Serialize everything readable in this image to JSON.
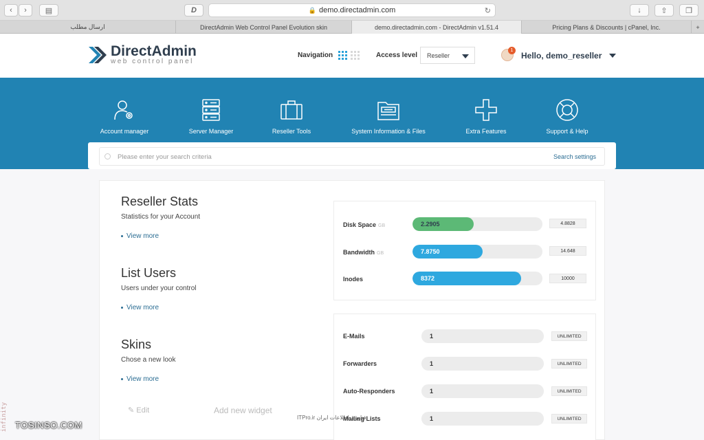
{
  "browser": {
    "url": "demo.directadmin.com",
    "tabs": [
      {
        "label": "ارسال مطلب",
        "active": false
      },
      {
        "label": "DirectAdmin Web Control Panel Evolution skin",
        "active": false
      },
      {
        "label": "demo.directadmin.com - DirectAdmin v1.51.4",
        "active": true
      },
      {
        "label": "Pricing Plans & Discounts | cPanel, Inc.",
        "active": false
      }
    ],
    "new_tab": "+"
  },
  "header": {
    "logo_title": "DirectAdmin",
    "logo_subtitle": "web control panel",
    "navigation_label": "Navigation",
    "access_level_label": "Access level",
    "access_level_value": "Reseller",
    "notification_count": "1",
    "greeting": "Hello, demo_reseller"
  },
  "main_menu": [
    {
      "label": "Account manager",
      "icon": "users-gear-icon"
    },
    {
      "label": "Server Manager",
      "icon": "server-icon"
    },
    {
      "label": "Reseller Tools",
      "icon": "briefcase-icon"
    },
    {
      "label": "System Information & Files",
      "icon": "folder-icon"
    },
    {
      "label": "Extra Features",
      "icon": "plus-icon"
    },
    {
      "label": "Support & Help",
      "icon": "lifebuoy-icon"
    }
  ],
  "search": {
    "placeholder": "Please enter your search criteria",
    "settings_label": "Search settings"
  },
  "widgets": [
    {
      "title": "Reseller Stats",
      "subtitle": "Statistics for your Account",
      "link": "View more"
    },
    {
      "title": "List Users",
      "subtitle": "Users under your control",
      "link": "View more"
    },
    {
      "title": "Skins",
      "subtitle": "Chose a new look",
      "link": "View more"
    }
  ],
  "widget_actions": {
    "edit": "Edit",
    "add": "Add new widget"
  },
  "usage": [
    {
      "label": "Disk Space",
      "unit": "GB",
      "value": "2.2905",
      "max": "4.8828",
      "fraction": 0.469,
      "color": "#5cb976"
    },
    {
      "label": "Bandwidth",
      "unit": "GB",
      "value": "7.8750",
      "max": "14.648",
      "fraction": 0.538,
      "color": "#2ea8df"
    },
    {
      "label": "Inodes",
      "unit": "",
      "value": "8372",
      "max": "10000",
      "fraction": 0.837,
      "color": "#2ea8df"
    }
  ],
  "quotas": [
    {
      "label": "E-Mails",
      "value": "1",
      "limit": "UNLIMITED"
    },
    {
      "label": "Forwarders",
      "value": "1",
      "limit": "UNLIMITED"
    },
    {
      "label": "Auto-Responders",
      "value": "1",
      "limit": "UNLIMITED"
    },
    {
      "label": "Mailing Lists",
      "value": "1",
      "limit": "UNLIMITED"
    }
  ],
  "watermarks": {
    "left": "TOSINSO.COM",
    "center": "ITPro.ir فناوری اطلاعات ایران",
    "side": "infinity"
  }
}
